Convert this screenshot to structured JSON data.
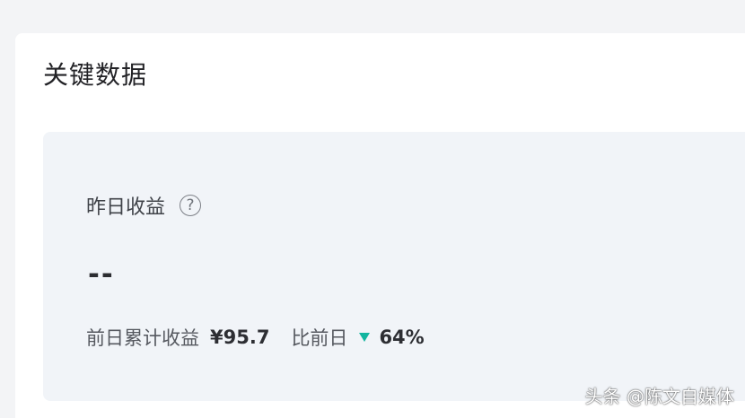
{
  "section": {
    "title": "关键数据"
  },
  "metric": {
    "label": "昨日收益",
    "help_icon": "?",
    "value": "--"
  },
  "comparison": {
    "previous_label": "前日累计收益",
    "previous_amount": "¥95.7",
    "change_label": "比前日",
    "trend_icon": "down-triangle",
    "change_percent": "64%",
    "trend_color": "#12b59f"
  },
  "watermark": {
    "text": "头条 @陈文自媒体"
  }
}
